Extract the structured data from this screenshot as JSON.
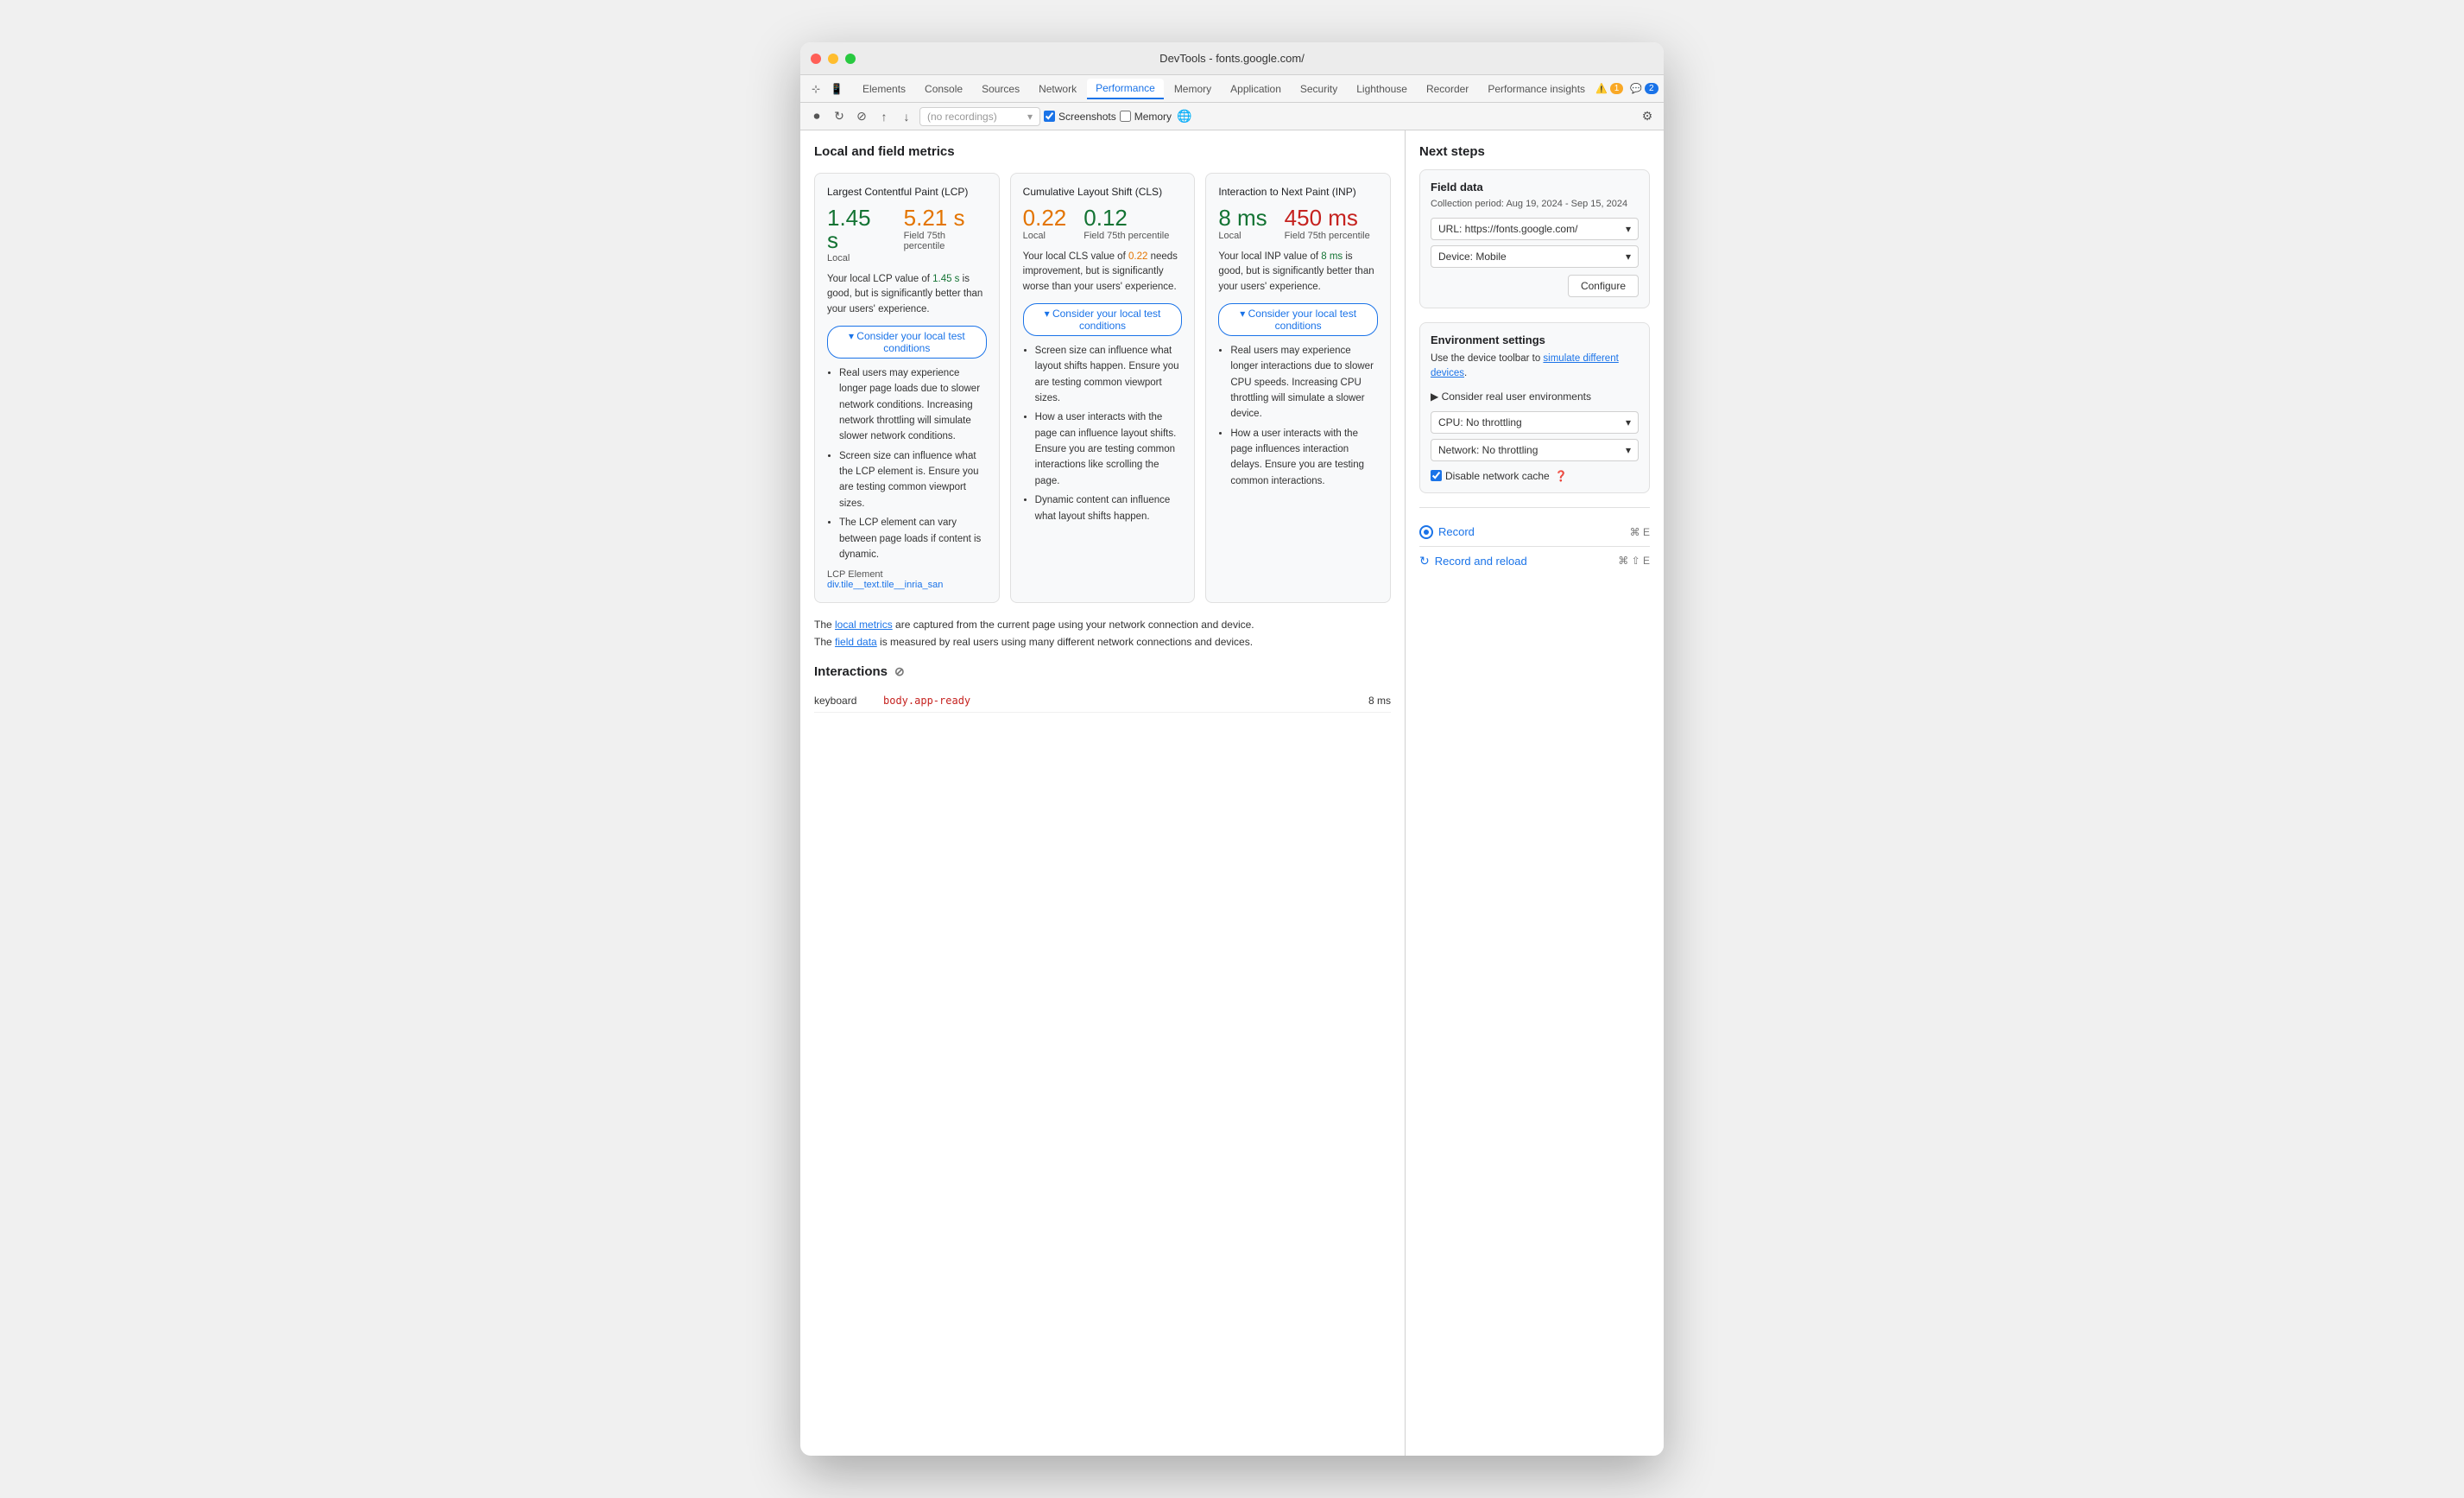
{
  "window": {
    "title": "DevTools - fonts.google.com/"
  },
  "tabs": {
    "items": [
      {
        "label": "Elements",
        "active": false
      },
      {
        "label": "Console",
        "active": false
      },
      {
        "label": "Sources",
        "active": false
      },
      {
        "label": "Network",
        "active": false
      },
      {
        "label": "Performance",
        "active": true
      },
      {
        "label": "Memory",
        "active": false
      },
      {
        "label": "Application",
        "active": false
      },
      {
        "label": "Security",
        "active": false
      },
      {
        "label": "Lighthouse",
        "active": false
      },
      {
        "label": "Recorder",
        "active": false
      },
      {
        "label": "Performance insights",
        "active": false
      }
    ],
    "warning_count": "1",
    "info_count": "2"
  },
  "toolbar": {
    "recording_placeholder": "(no recordings)",
    "screenshots_label": "Screenshots",
    "memory_label": "Memory"
  },
  "main": {
    "section_title": "Local and field metrics",
    "metrics": [
      {
        "id": "lcp",
        "title": "Largest Contentful Paint (LCP)",
        "local_value": "1.45 s",
        "local_label": "Local",
        "field_value": "5.21 s",
        "field_label": "Field 75th percentile",
        "local_class": "good",
        "field_class": "needs-improvement",
        "description": "Your local LCP value of 1.45 s is good, but is significantly better than your users' experience.",
        "consider_label": "▾ Consider your local test conditions",
        "bullets": [
          "Real users may experience longer page loads due to slower network conditions. Increasing network throttling will simulate slower network conditions.",
          "Screen size can influence what the LCP element is. Ensure you are testing common viewport sizes.",
          "The LCP element can vary between page loads if content is dynamic."
        ],
        "lcp_element_prefix": "LCP Element",
        "lcp_element_value": "div.tile__text.tile__inria_san"
      },
      {
        "id": "cls",
        "title": "Cumulative Layout Shift (CLS)",
        "local_value": "0.22",
        "local_label": "Local",
        "field_value": "0.12",
        "field_label": "Field 75th percentile",
        "local_class": "needs-improvement",
        "field_class": "good",
        "description": "Your local CLS value of 0.22 needs improvement, but is significantly worse than your users' experience.",
        "consider_label": "▾ Consider your local test conditions",
        "bullets": [
          "Screen size can influence what layout shifts happen. Ensure you are testing common viewport sizes.",
          "How a user interacts with the page can influence layout shifts. Ensure you are testing common interactions like scrolling the page.",
          "Dynamic content can influence what layout shifts happen."
        ]
      },
      {
        "id": "inp",
        "title": "Interaction to Next Paint (INP)",
        "local_value": "8 ms",
        "local_label": "Local",
        "field_value": "450 ms",
        "field_label": "Field 75th percentile",
        "local_class": "good",
        "field_class": "poor",
        "description": "Your local INP value of 8 ms is good, but is significantly better than your users' experience.",
        "consider_label": "▾ Consider your local test conditions",
        "bullets": [
          "Real users may experience longer interactions due to slower CPU speeds. Increasing CPU throttling will simulate a slower device.",
          "How a user interacts with the page influences interaction delays. Ensure you are testing common interactions."
        ]
      }
    ],
    "field_note_1": "The local metrics are captured from the current page using your network connection and device.",
    "field_note_link1": "local metrics",
    "field_note_2": "The field data is measured by real users using many different network connections and devices.",
    "field_note_link2": "field data",
    "interactions_title": "Interactions",
    "interactions": [
      {
        "type": "keyboard",
        "target": "body.app-ready",
        "time": "8 ms"
      }
    ]
  },
  "sidebar": {
    "next_steps_title": "Next steps",
    "field_data": {
      "title": "Field data",
      "collection_period": "Collection period: Aug 19, 2024 - Sep 15, 2024",
      "url_label": "URL: https://fonts.google.com/",
      "device_label": "Device: Mobile",
      "configure_label": "Configure"
    },
    "environment": {
      "title": "Environment settings",
      "description": "Use the device toolbar to simulate different devices.",
      "simulate_link": "simulate different devices",
      "consider_label": "▶ Consider real user environments",
      "cpu_label": "CPU: No throttling",
      "network_label": "Network: No throttling",
      "disable_cache_label": "Disable network cache"
    },
    "record": {
      "label": "Record",
      "shortcut": "⌘ E"
    },
    "record_reload": {
      "label": "Record and reload",
      "shortcut": "⌘ ⇧ E"
    }
  }
}
